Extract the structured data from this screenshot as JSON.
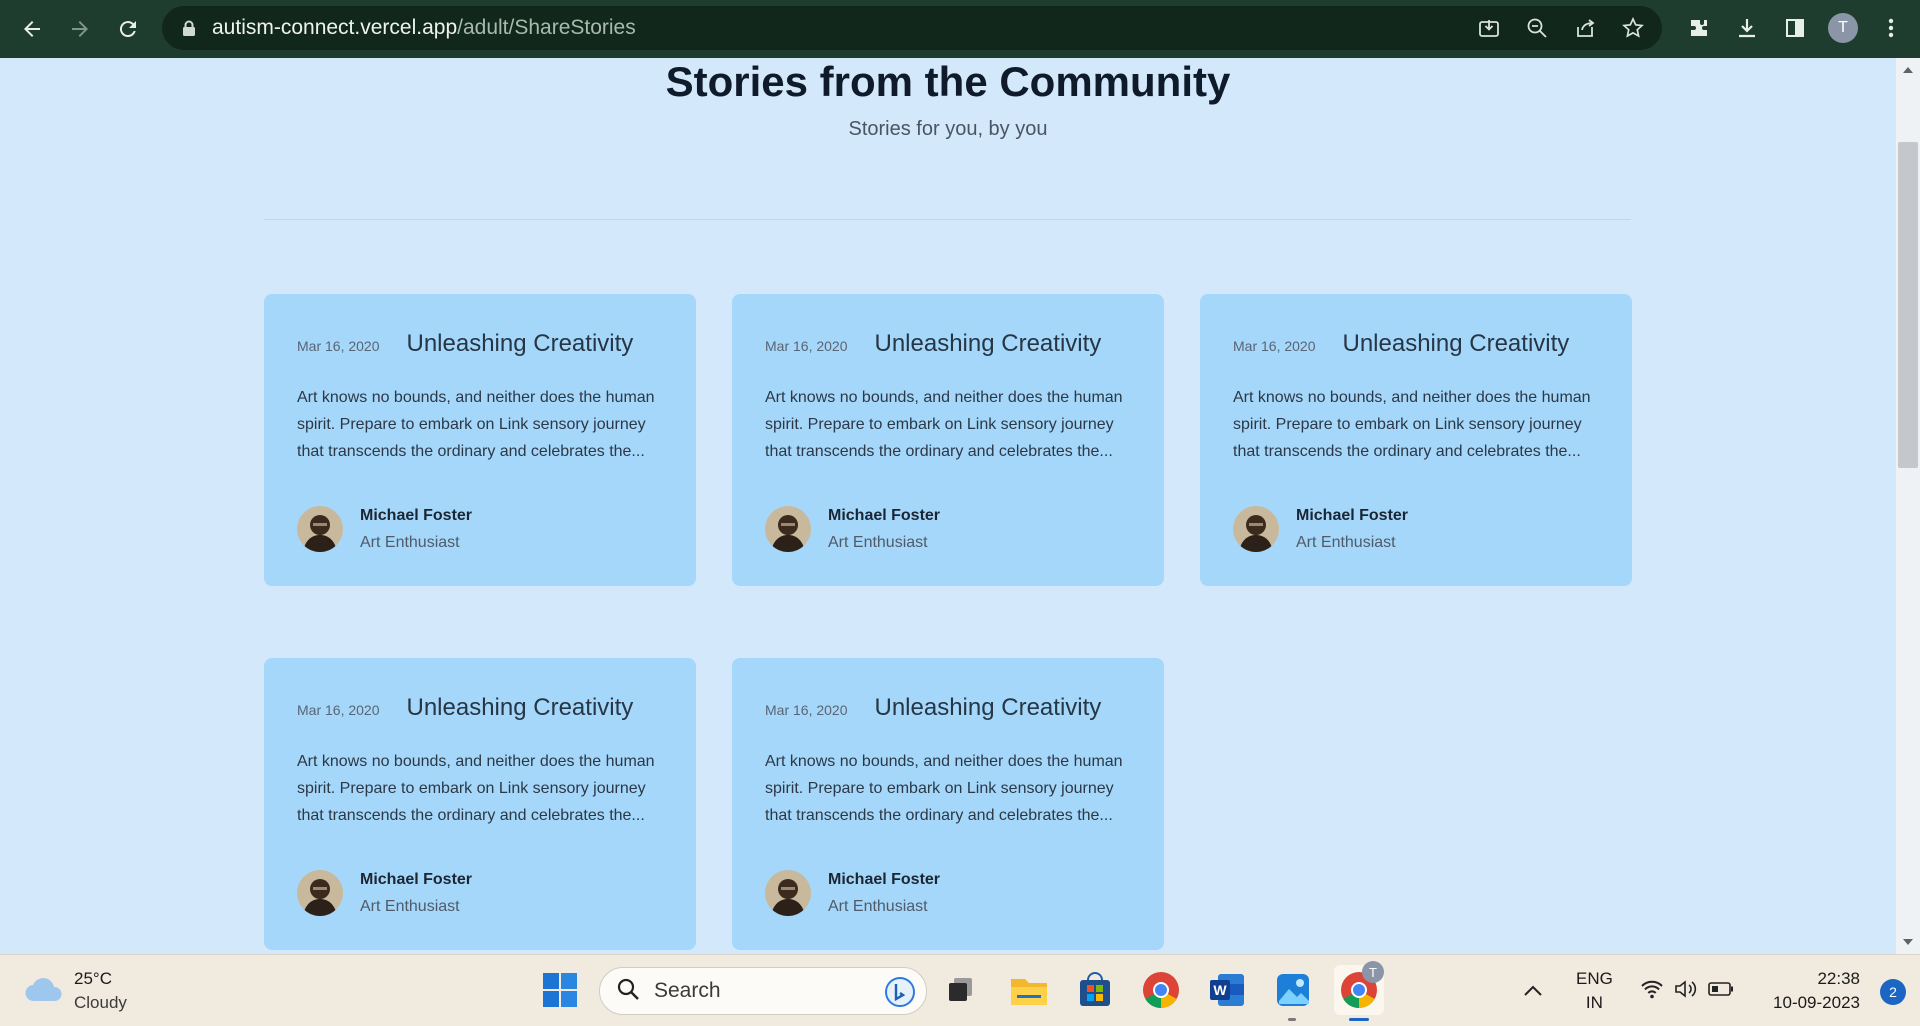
{
  "browser": {
    "url_host": "autism-connect.vercel.app",
    "url_path": "/adult/ShareStories",
    "profile_initial": "T",
    "icons": [
      "back-icon",
      "forward-icon",
      "reload-icon",
      "lock-icon",
      "install-icon",
      "zoom-icon",
      "share-icon",
      "star-icon",
      "extensions-icon",
      "download-icon",
      "sidepanel-icon",
      "menu-icon"
    ]
  },
  "page": {
    "title": "Stories from the Community",
    "subtitle": "Stories for you, by you"
  },
  "stories": [
    {
      "date": "Mar 16, 2020",
      "title": "Unleashing Creativity",
      "excerpt": "Art knows no bounds, and neither does the human spirit. Prepare to embark on Link sensory journey that transcends the ordinary and celebrates the...",
      "author": "Michael Foster",
      "role": "Art Enthusiast"
    },
    {
      "date": "Mar 16, 2020",
      "title": "Unleashing Creativity",
      "excerpt": "Art knows no bounds, and neither does the human spirit. Prepare to embark on Link sensory journey that transcends the ordinary and celebrates the...",
      "author": "Michael Foster",
      "role": "Art Enthusiast"
    },
    {
      "date": "Mar 16, 2020",
      "title": "Unleashing Creativity",
      "excerpt": "Art knows no bounds, and neither does the human spirit. Prepare to embark on Link sensory journey that transcends the ordinary and celebrates the...",
      "author": "Michael Foster",
      "role": "Art Enthusiast"
    },
    {
      "date": "Mar 16, 2020",
      "title": "Unleashing Creativity",
      "excerpt": "Art knows no bounds, and neither does the human spirit. Prepare to embark on Link sensory journey that transcends the ordinary and celebrates the...",
      "author": "Michael Foster",
      "role": "Art Enthusiast"
    },
    {
      "date": "Mar 16, 2020",
      "title": "Unleashing Creativity",
      "excerpt": "Art knows no bounds, and neither does the human spirit. Prepare to embark on Link sensory journey that transcends the ordinary and celebrates the...",
      "author": "Michael Foster",
      "role": "Art Enthusiast"
    }
  ],
  "taskbar": {
    "weather_temp": "25°C",
    "weather_condition": "Cloudy",
    "search_label": "Search",
    "language_line1": "ENG",
    "language_line2": "IN",
    "time": "22:38",
    "date": "10-09-2023",
    "notification_count": "2",
    "chrome_badge": "T"
  },
  "colors": {
    "page_background": "#d3e8fb",
    "card_background": "#a5d7fa",
    "chrome_background": "#1f3d2e"
  }
}
